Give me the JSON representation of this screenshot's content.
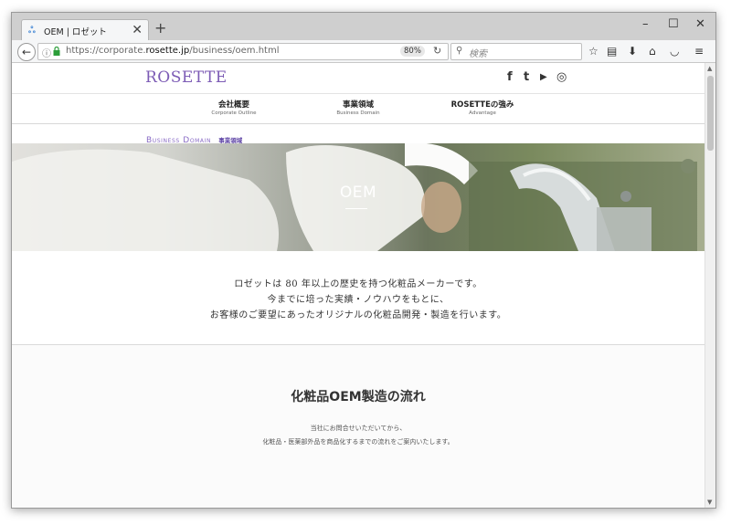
{
  "browser": {
    "tab_title": "OEM | ロゼット",
    "tab_close": "✕",
    "new_tab": "+",
    "window_controls": {
      "minimize": "–",
      "maximize": "☐",
      "close": "✕"
    },
    "url_prefix": "https://corporate.",
    "url_domain": "rosette.jp",
    "url_path": "/business/oem.html",
    "zoom": "80%",
    "search_placeholder": "検索",
    "toolbar_icons": [
      "star-icon",
      "reading-list-icon",
      "download-icon",
      "home-icon",
      "pocket-icon",
      "menu-icon"
    ]
  },
  "site": {
    "logo": "ROSETTE",
    "social": {
      "facebook": "f",
      "twitter": "t",
      "youtube": "▶",
      "instagram": "◎"
    },
    "nav": [
      {
        "jp": "会社概要",
        "en": "Corporate Outline"
      },
      {
        "jp": "事業領域",
        "en": "Business Domain"
      },
      {
        "jp": "ROSETTEの強み",
        "en": "Advantage"
      }
    ],
    "breadcrumb": {
      "en": "Business Domain",
      "jp": "事業領域"
    },
    "hero_title": "OEM",
    "intro": [
      "ロゼットは 80 年以上の歴史を持つ化粧品メーカーです。",
      "今までに培った実績・ノウハウをもとに、",
      "お客様のご要望にあったオリジナルの化粧品開発・製造を行います。"
    ],
    "flow": {
      "title": "化粧品OEM製造の流れ",
      "desc": [
        "当社にお問合せいただいてから、",
        "化粧品・医薬部外品を商品化するまでの流れをご案内いたします。"
      ]
    }
  },
  "colors": {
    "brand": "#7c5bb5",
    "accent": "#5f45a6"
  }
}
